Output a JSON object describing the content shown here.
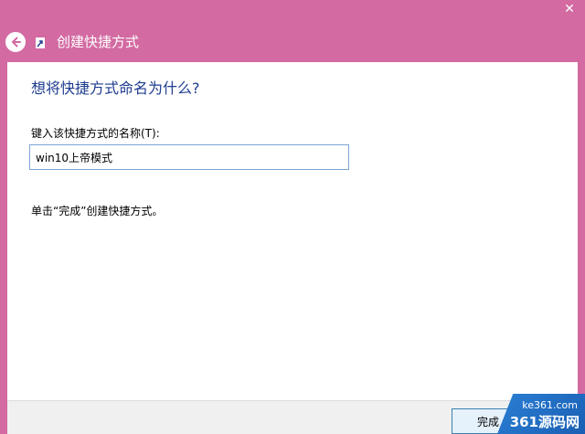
{
  "window": {
    "title": "创建快捷方式",
    "close_label": "✕",
    "back_icon": "back-arrow-icon",
    "app_icon": "shortcut-arrow-icon"
  },
  "main": {
    "heading": "想将快捷方式命名为什么?",
    "field_label": "键入该快捷方式的名称(T):",
    "name_value": "win10上帝模式",
    "hint": "单击“完成”创建快捷方式。"
  },
  "footer": {
    "finish_label": "完成"
  },
  "watermark": {
    "site": "ke361.com",
    "brand": "361源码网"
  },
  "colors": {
    "accent": "#d36aa2",
    "heading": "#1e3d8f",
    "input_border": "#7ea6d6",
    "watermark": "#1a5fb4"
  }
}
